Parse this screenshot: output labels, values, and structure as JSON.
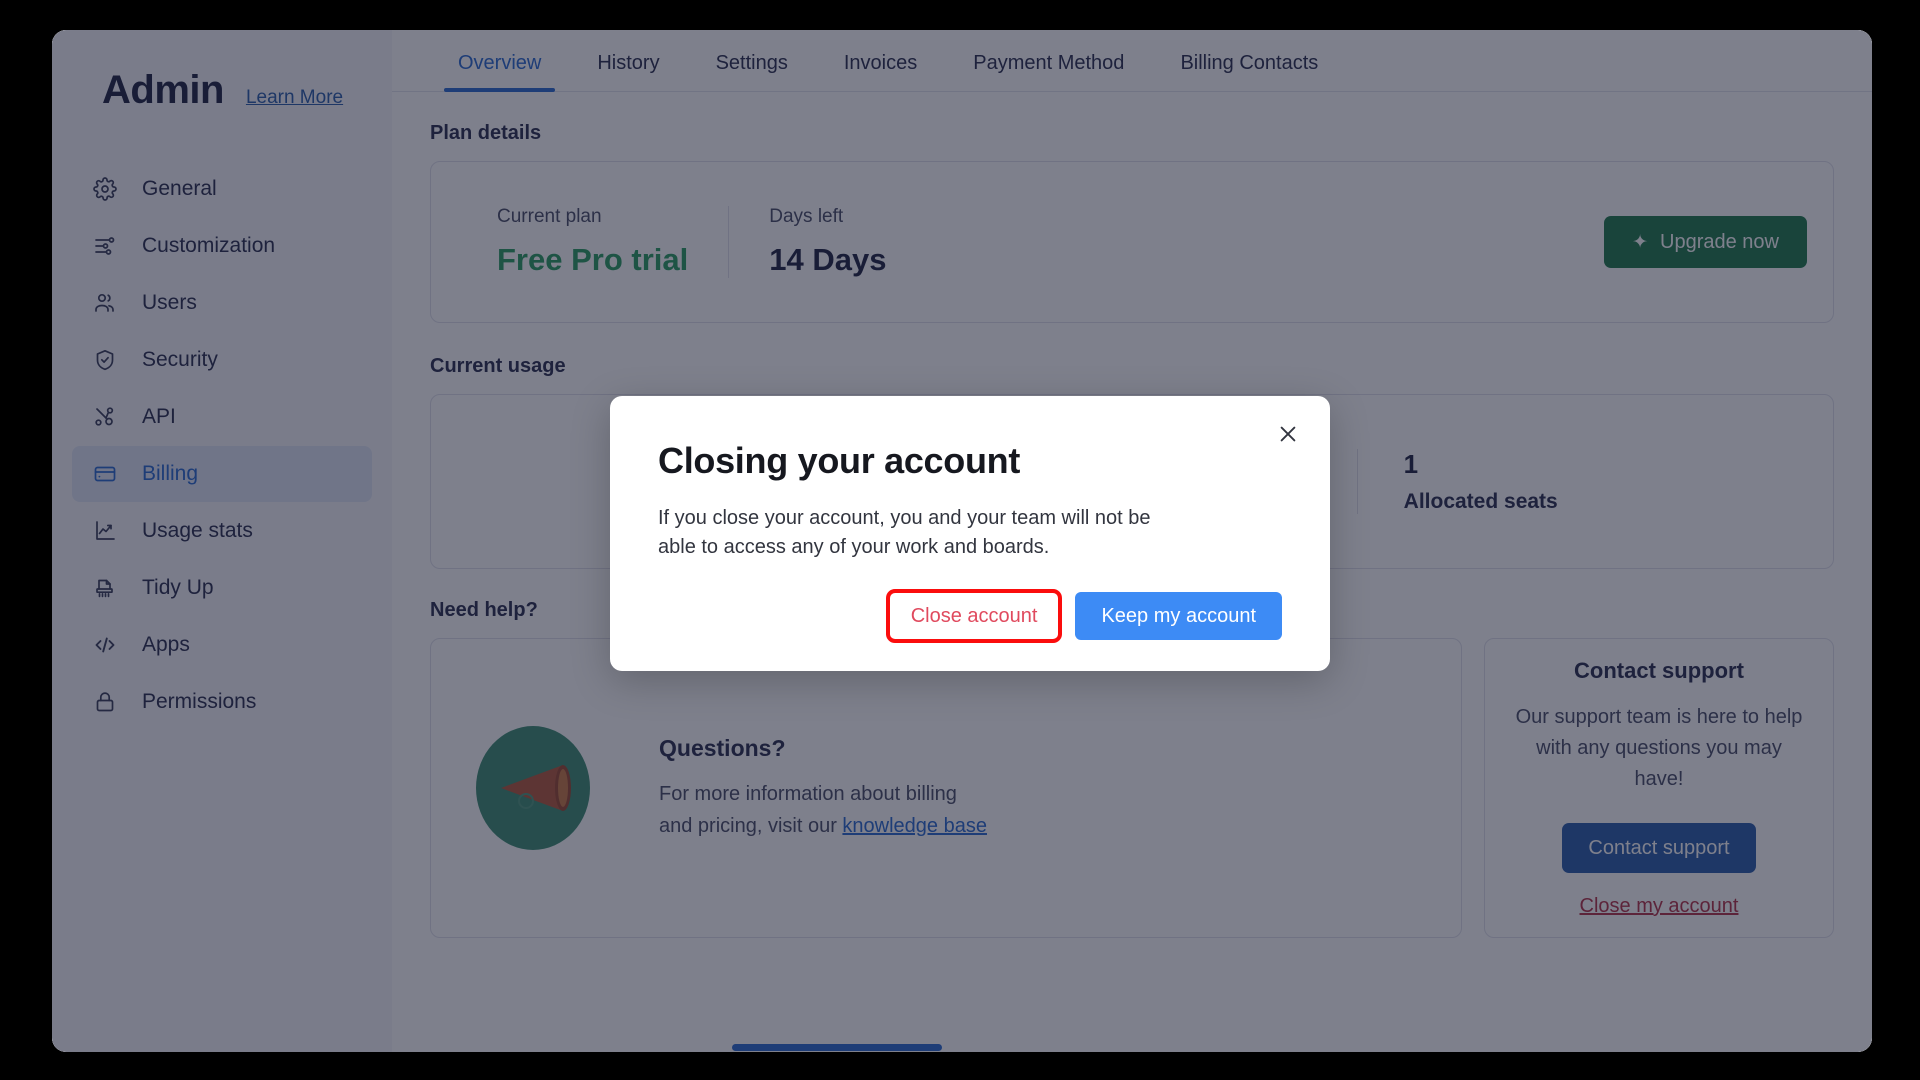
{
  "sidebar": {
    "title": "Admin",
    "learn_more": "Learn More",
    "items": [
      {
        "label": "General",
        "icon": "gear-icon"
      },
      {
        "label": "Customization",
        "icon": "sliders-icon"
      },
      {
        "label": "Users",
        "icon": "users-icon"
      },
      {
        "label": "Security",
        "icon": "shield-check-icon"
      },
      {
        "label": "API",
        "icon": "nodes-icon"
      },
      {
        "label": "Billing",
        "icon": "credit-card-icon"
      },
      {
        "label": "Usage stats",
        "icon": "line-chart-icon"
      },
      {
        "label": "Tidy Up",
        "icon": "shredder-icon"
      },
      {
        "label": "Apps",
        "icon": "code-icon"
      },
      {
        "label": "Permissions",
        "icon": "lock-icon"
      }
    ],
    "active_item": "Billing"
  },
  "tabs": {
    "items": [
      "Overview",
      "History",
      "Settings",
      "Invoices",
      "Payment Method",
      "Billing Contacts"
    ],
    "active": "Overview"
  },
  "plan_details": {
    "section_label": "Plan details",
    "current_plan_label": "Current plan",
    "current_plan_value": "Free Pro trial",
    "days_left_label": "Days left",
    "days_left_value": "14 Days",
    "upgrade_button": "Upgrade now",
    "upgrade_icon": "sparkle-icon"
  },
  "current_usage": {
    "section_label": "Current usage",
    "allocated_seats_value": "1",
    "allocated_seats_label": "Allocated seats"
  },
  "need_help": {
    "section_label": "Need help?",
    "questions": {
      "title": "Questions?",
      "text_before": "For more information about billing and pricing, visit our ",
      "link": "knowledge base",
      "illustration": "megaphone-illustration"
    },
    "support": {
      "title": "Contact support",
      "text": "Our support team is here to help with any questions you may have!",
      "button": "Contact support",
      "close_link": "Close my account"
    }
  },
  "modal": {
    "title": "Closing your account",
    "body": "If you close your account, you and your team will not be able to access any of your work and boards.",
    "close_account_button": "Close account",
    "keep_account_button": "Keep my account",
    "close_icon": "close-icon"
  },
  "colors": {
    "accent_blue": "#2b6ad0",
    "primary_button_blue": "#3d8bf5",
    "danger_red": "#e04a5e",
    "highlight_red": "#fb0d0d",
    "trial_green": "#2b9e62",
    "upgrade_green": "#1f7a4d",
    "support_blue": "#2b5eab"
  }
}
